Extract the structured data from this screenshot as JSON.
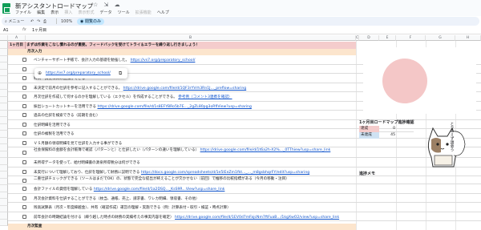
{
  "app": {
    "title": "新アシスタントロードマップ",
    "title_icons": [
      "☆",
      "⇲",
      "☁"
    ],
    "menu": [
      {
        "label": "ファイル",
        "disabled": false
      },
      {
        "label": "編集",
        "disabled": false
      },
      {
        "label": "表示",
        "disabled": false
      },
      {
        "label": "挿入",
        "disabled": true
      },
      {
        "label": "表示形式",
        "disabled": true
      },
      {
        "label": "データ",
        "disabled": false
      },
      {
        "label": "ツール",
        "disabled": false
      },
      {
        "label": "拡張機能",
        "disabled": true
      },
      {
        "label": "ヘルプ",
        "disabled": false
      }
    ]
  },
  "toolbar": {
    "search_label": "メニュー",
    "zoom": "100%",
    "mode_label": "閲覧のみ"
  },
  "formula_bar": {
    "cell_ref": "A1",
    "fx": "fx",
    "content": "1ヶ月目"
  },
  "columns": [
    "A",
    "B",
    "C",
    "D",
    "E",
    "F",
    "G",
    "H"
  ],
  "sheet": {
    "label_cell": "1ヶ月目",
    "banner": "まずは作業をこなし慣れるのが重要。フィードバックを受けてトライ＆エラーを繰り返し行きましょう！",
    "section_1": "月次入力",
    "tasks": [
      {
        "text": "ベンチャーサポート手帳で、会計入力の基礎を勉強した。",
        "url": "https://vs7.org/preparatory_school/"
      },
      {
        "text": "",
        "url": ""
      },
      {
        "text": "科目・摘要科目の追加ができる",
        "url": ""
      },
      {
        "text": "未決定で前月の仕訳を参考に記入することができる。",
        "url": "https://drive.google.com/file/d/1QF3rYVrh3Rn1J..._preflow=sharing"
      },
      {
        "text": "月次仕訳を作成して何するのかを理解している（エクセル）を作成することができる。",
        "url": "参考例（コメント3連携を確認）"
      },
      {
        "text": "振出ショートカットキーを活用できる",
        "url": "https://drive.google.com/file/d/1s8EFYBRo5b7E..._2gZL80pg3oRfiView?usp=sharing"
      },
      {
        "text": "過去の仕訳を検索できる（前期を含む）",
        "url": ""
      },
      {
        "text": "仕訳明細を活用できる",
        "url": ""
      },
      {
        "text": "仕訳の複製を活用できる",
        "url": ""
      },
      {
        "text": "ＶＳ月額の領収明細を見て仕訳を入力する事ができる",
        "url": ""
      },
      {
        "text": "社会保険料の金額を会計帳簿で確認（パターンと）と仕訳したい（パターンの違いを理解している）",
        "url": "https://drive.google.com/file/d/1t6a2h-X2%..._0TThiew?usp=share_link"
      },
      {
        "text": "未所得データを使って、給付明細書の源泉所得税分は何ができる",
        "url": ""
      },
      {
        "text": "未実行について理解しており、仕訳を理解して財務に説明できる",
        "url": "https://docs.google.com/spreadsheets/d/1e5IEeZm1fkt..._..._m8gsbhqrFY/edit?usp=sharing"
      },
      {
        "text": "二重仕訳チェックができる（ツールはまだでOK）の、状態で完全な提出が終えることが欠かせない（前回）で推移の比較指標がある（今月の移動・注目）",
        "url": ""
      },
      {
        "text": "会計ファイルの貸借を理解している",
        "url": "https://drive.google.com/file/d/1a2DSQ..._KsS9R...View?usp=share_link"
      },
      {
        "text": "月次会計資料を仕訳することができる（枚当、通帳、売上、請求書、ワレカ明細、領収書、その他）",
        "url": ""
      },
      {
        "text": "残高試算表（月次・年度繰越金）、共有（確認作成）運営の理解・実施できる（例：計算表付・取引・検証・時点計算）",
        "url": ""
      },
      {
        "text": "前年会計の時期結論を付ける（繰り越した時点の財務の実績考えの事実内容を確定）",
        "url": "https://drive.google.com/file/d/1EV0d7mFajcNm7ftFuaB.../1kgXwO2/view?usp=share_link"
      }
    ],
    "section_2": "月次監査"
  },
  "popup": {
    "globe_icon": "globe-icon",
    "url": "https://vs7.org/preparatory_school/",
    "copy_icon": "copy-icon"
  },
  "right_panel": {
    "progress_title": "1ヶ月目ロードマップ進捗確認",
    "rows": [
      {
        "label": "達成",
        "value": "0",
        "color": "#f4cccc"
      },
      {
        "label": "未達成",
        "value": "45",
        "color": "#cfe2f3"
      }
    ],
    "memo_title": "進捗メモ",
    "mascot_text": "とりあえず頑張ろ"
  },
  "chart_data": {
    "type": "pie",
    "categories": [
      "達成",
      "未達成"
    ],
    "values": [
      0,
      45
    ],
    "colors": [
      "#e06666",
      "#f4c7c7"
    ]
  }
}
